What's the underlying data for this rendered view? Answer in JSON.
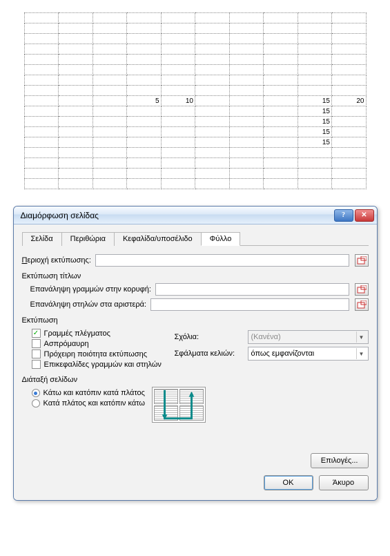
{
  "sheet": {
    "rows": 17,
    "cols": 10,
    "data": {
      "8": {
        "3": "5",
        "4": "10",
        "8": "15",
        "9": "20"
      },
      "9": {
        "8": "15"
      },
      "10": {
        "8": "15"
      },
      "11": {
        "8": "15"
      },
      "12": {
        "8": "15"
      }
    }
  },
  "dialog": {
    "title": "Διαμόρφωση σελίδας",
    "tabs": [
      "Σελίδα",
      "Περιθώρια",
      "Κεφαλίδα/υποσέλιδο",
      "Φύλλο"
    ],
    "active_tab": 3,
    "print_area": {
      "label": "Περιοχή εκτύπωσης:",
      "value": ""
    },
    "titles_group": "Εκτύπωση τίτλων",
    "repeat_rows": {
      "label": "Επανάληψη γραμμών στην κορυφή:",
      "value": ""
    },
    "repeat_cols": {
      "label": "Επανάληψη στηλών στα αριστερά:",
      "value": ""
    },
    "print_group": "Εκτύπωση",
    "checks": {
      "gridlines": {
        "label": "Γραμμές πλέγματος",
        "checked": true
      },
      "bw": {
        "label": "Ασπρόμαυρη",
        "checked": false
      },
      "draft": {
        "label": "Πρόχειρη ποιότητα εκτύπωσης",
        "checked": false
      },
      "headings": {
        "label": "Επικεφαλίδες γραμμών και στηλών",
        "checked": false
      }
    },
    "comments": {
      "label": "Σχόλια:",
      "value": "(Κανένα)"
    },
    "cell_errors": {
      "label": "Σφάλματα κελιών:",
      "value": "όπως εμφανίζονται"
    },
    "order_group": "Διάταξή σελίδων",
    "order": {
      "down_over": {
        "label": "Κάτω και κατόπιν κατά πλάτος",
        "selected": true
      },
      "over_down": {
        "label": "Κατά πλάτος και κατόπιν κάτω",
        "selected": false
      }
    },
    "buttons": {
      "options": "Επιλογές...",
      "ok": "OK",
      "cancel": "Άκυρο"
    }
  }
}
